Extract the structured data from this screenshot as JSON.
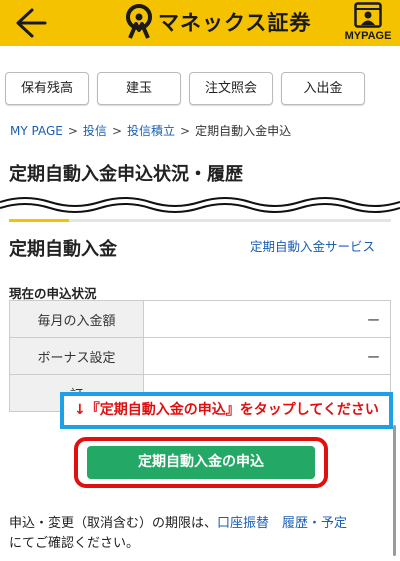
{
  "header": {
    "logo_text": "マネックス証券",
    "mypage_label": "MYPAGE",
    "colors": {
      "brand": "#f5c200"
    },
    "icons": [
      "back-arrow-icon",
      "monex-logo-icon",
      "mypage-icon"
    ]
  },
  "tabs": [
    {
      "label": "保有残高"
    },
    {
      "label": "建玉"
    },
    {
      "label": "注文照会"
    },
    {
      "label": "入出金"
    }
  ],
  "breadcrumb": {
    "items": [
      "MY PAGE",
      "投信",
      "投信積立"
    ],
    "current": "定期自動入金申込",
    "separator": ">"
  },
  "page": {
    "title": "定期自動入金申込状況・履歴"
  },
  "section": {
    "title": "定期自動入金",
    "service_link": "定期自動入金サービス",
    "status_label": "現在の申込状況",
    "rows": [
      {
        "label": "毎月の入金額",
        "value": "ー"
      },
      {
        "label": "ボーナス設定",
        "value": "ー"
      },
      {
        "label": "訂",
        "value": ""
      }
    ]
  },
  "callout": {
    "text": "↓『定期自動入金の申込』をタップしてください",
    "colors": {
      "border": "#1ea0e6",
      "text": "#e01010"
    }
  },
  "apply_button": {
    "label": "定期自動入金の申込",
    "colors": {
      "fill": "#24a865",
      "highlight": "#e01010"
    }
  },
  "note": {
    "prefix": "申込・変更（取消含む）の期限は、",
    "link1": "口座振替",
    "link2": "履歴・予定",
    "suffix": "にてご確認ください。"
  }
}
